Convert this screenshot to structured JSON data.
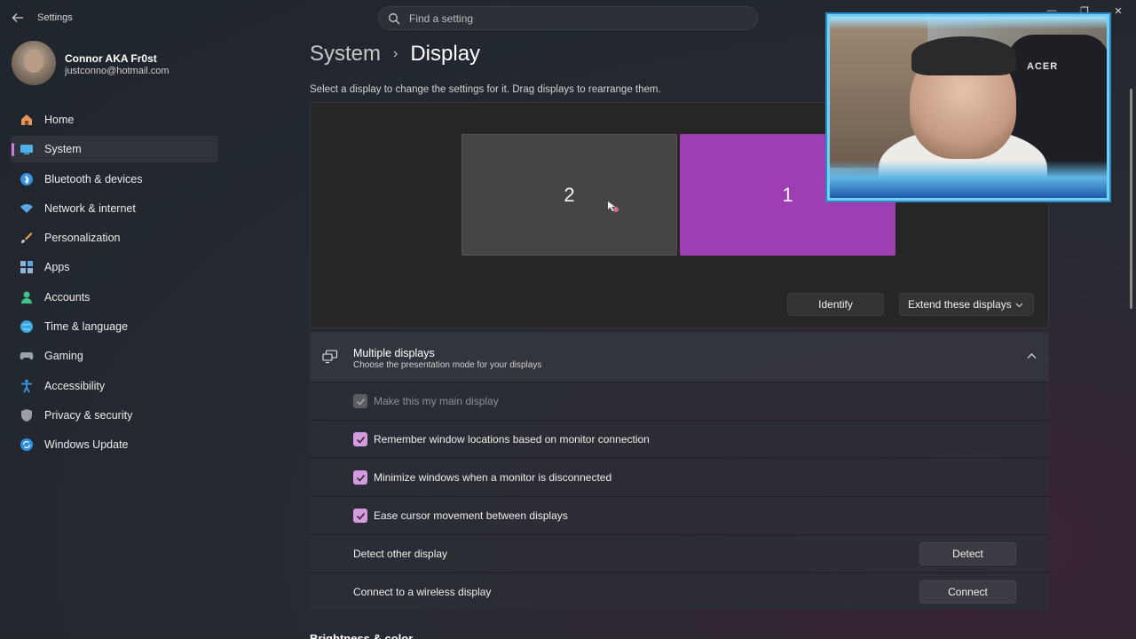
{
  "window": {
    "app_title": "Settings",
    "controls": {
      "minimize": "—",
      "maximize": "❐",
      "close": "✕"
    }
  },
  "search": {
    "placeholder": "Find a setting"
  },
  "profile": {
    "name": "Connor AKA Fr0st",
    "email": "justconno@hotmail.com"
  },
  "nav": {
    "items": [
      {
        "label": "Home",
        "icon": "home-icon",
        "color": "#e8935a"
      },
      {
        "label": "System",
        "icon": "system-icon",
        "color": "#4fb0e8",
        "active": true
      },
      {
        "label": "Bluetooth & devices",
        "icon": "bluetooth-icon",
        "color": "#3a8fe0"
      },
      {
        "label": "Network & internet",
        "icon": "wifi-icon",
        "color": "#5aa9e6"
      },
      {
        "label": "Personalization",
        "icon": "brush-icon",
        "color": "#e6a25a"
      },
      {
        "label": "Apps",
        "icon": "apps-icon",
        "color": "#8fb4d6"
      },
      {
        "label": "Accounts",
        "icon": "accounts-icon",
        "color": "#3fc28a"
      },
      {
        "label": "Time & language",
        "icon": "globe-icon",
        "color": "#3aa7e0"
      },
      {
        "label": "Gaming",
        "icon": "gamepad-icon",
        "color": "#9aa3ad"
      },
      {
        "label": "Accessibility",
        "icon": "accessibility-icon",
        "color": "#3a9be6"
      },
      {
        "label": "Privacy & security",
        "icon": "shield-icon",
        "color": "#9a9ea6"
      },
      {
        "label": "Windows Update",
        "icon": "update-icon",
        "color": "#2f8fe0"
      }
    ]
  },
  "breadcrumb": {
    "parent": "System",
    "separator": "›",
    "current": "Display"
  },
  "display_hint": "Select a display to change the settings for it. Drag displays to rearrange them.",
  "displays": {
    "monitor_2": "2",
    "monitor_1": "1",
    "identify_label": "Identify",
    "mode_selected": "Extend these displays",
    "accent_color": "#9e3eb3"
  },
  "multiple_displays": {
    "title": "Multiple displays",
    "subtitle": "Choose the presentation mode for your displays",
    "options": [
      {
        "label": "Make this my main display",
        "checked": true,
        "disabled": true
      },
      {
        "label": "Remember window locations based on monitor connection",
        "checked": true
      },
      {
        "label": "Minimize windows when a monitor is disconnected",
        "checked": true
      },
      {
        "label": "Ease cursor movement between displays",
        "checked": true
      }
    ],
    "detect": {
      "label": "Detect other display",
      "button": "Detect"
    },
    "connect": {
      "label": "Connect to a wireless display",
      "button": "Connect"
    }
  },
  "next_section_title": "Brightness & color",
  "webcam": {
    "chair_brand": "ACER"
  }
}
